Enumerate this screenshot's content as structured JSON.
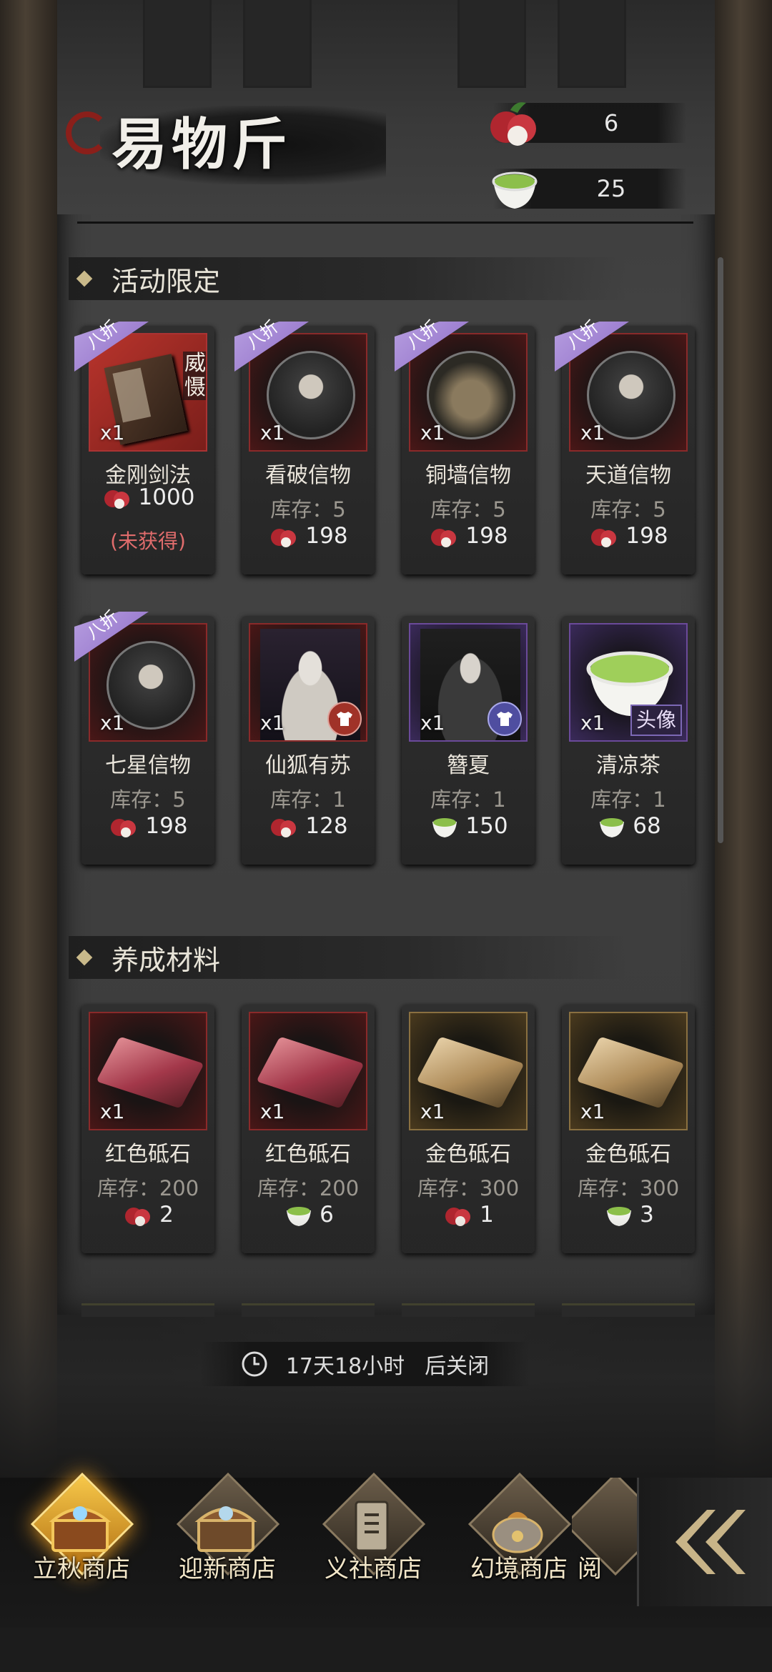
{
  "header": {
    "title": "易物斤",
    "currencies": [
      {
        "icon": "lychee-icon",
        "value": "6"
      },
      {
        "icon": "tea-cup-icon",
        "value": "25"
      }
    ]
  },
  "sections": [
    {
      "label": "活动限定",
      "items": [
        {
          "name": "金刚剑法",
          "qty": "x1",
          "ribbon": "八折",
          "tag": "威慑",
          "price": "1000",
          "currency": "lychee-icon",
          "status": "(未获得)"
        },
        {
          "name": "看破信物",
          "qty": "x1",
          "ribbon": "八折",
          "stock": "库存：5",
          "price": "198",
          "currency": "lychee-icon"
        },
        {
          "name": "铜墙信物",
          "qty": "x1",
          "ribbon": "八折",
          "stock": "库存：5",
          "price": "198",
          "currency": "lychee-icon"
        },
        {
          "name": "天道信物",
          "qty": "x1",
          "ribbon": "八折",
          "stock": "库存：5",
          "price": "198",
          "currency": "lychee-icon"
        },
        {
          "name": "七星信物",
          "qty": "x1",
          "ribbon": "八折",
          "stock": "库存：5",
          "price": "198",
          "currency": "lychee-icon"
        },
        {
          "name": "仙狐有苏",
          "qty": "x1",
          "stock": "库存：1",
          "price": "128",
          "currency": "lychee-icon"
        },
        {
          "name": "簪夏",
          "qty": "x1",
          "stock": "库存：1",
          "price": "150",
          "currency": "tea-cup-icon"
        },
        {
          "name": "清凉茶",
          "qty": "x1",
          "tag": "头像",
          "stock": "库存：1",
          "price": "68",
          "currency": "tea-cup-icon"
        }
      ]
    },
    {
      "label": "养成材料",
      "items": [
        {
          "name": "红色砥石",
          "qty": "x1",
          "stock": "库存：200",
          "price": "2",
          "currency": "lychee-icon"
        },
        {
          "name": "红色砥石",
          "qty": "x1",
          "stock": "库存：200",
          "price": "6",
          "currency": "tea-cup-icon"
        },
        {
          "name": "金色砥石",
          "qty": "x1",
          "stock": "库存：300",
          "price": "1",
          "currency": "lychee-icon"
        },
        {
          "name": "金色砥石",
          "qty": "x1",
          "stock": "库存：300",
          "price": "3",
          "currency": "tea-cup-icon"
        }
      ]
    }
  ],
  "timer": {
    "remaining": "17天18小时",
    "suffix": "后关闭"
  },
  "tabs": [
    {
      "label": "立秋商店",
      "icon": "treasure-chest-icon",
      "active": true
    },
    {
      "label": "迎新商店",
      "icon": "treasure-chest-icon",
      "active": false
    },
    {
      "label": "义社商店",
      "icon": "scroll-icon",
      "active": false
    },
    {
      "label": "幻境商店",
      "icon": "money-bag-icon",
      "active": false
    },
    {
      "label": "阅",
      "icon": "book-icon",
      "active": false
    }
  ],
  "colors": {
    "accent_purple": "#8d6cc6",
    "lychee_red": "#c0323a",
    "tea_green": "#8cbf4a",
    "warning_red": "#e06c6c",
    "active_tab_gold": "#f7c84a"
  }
}
